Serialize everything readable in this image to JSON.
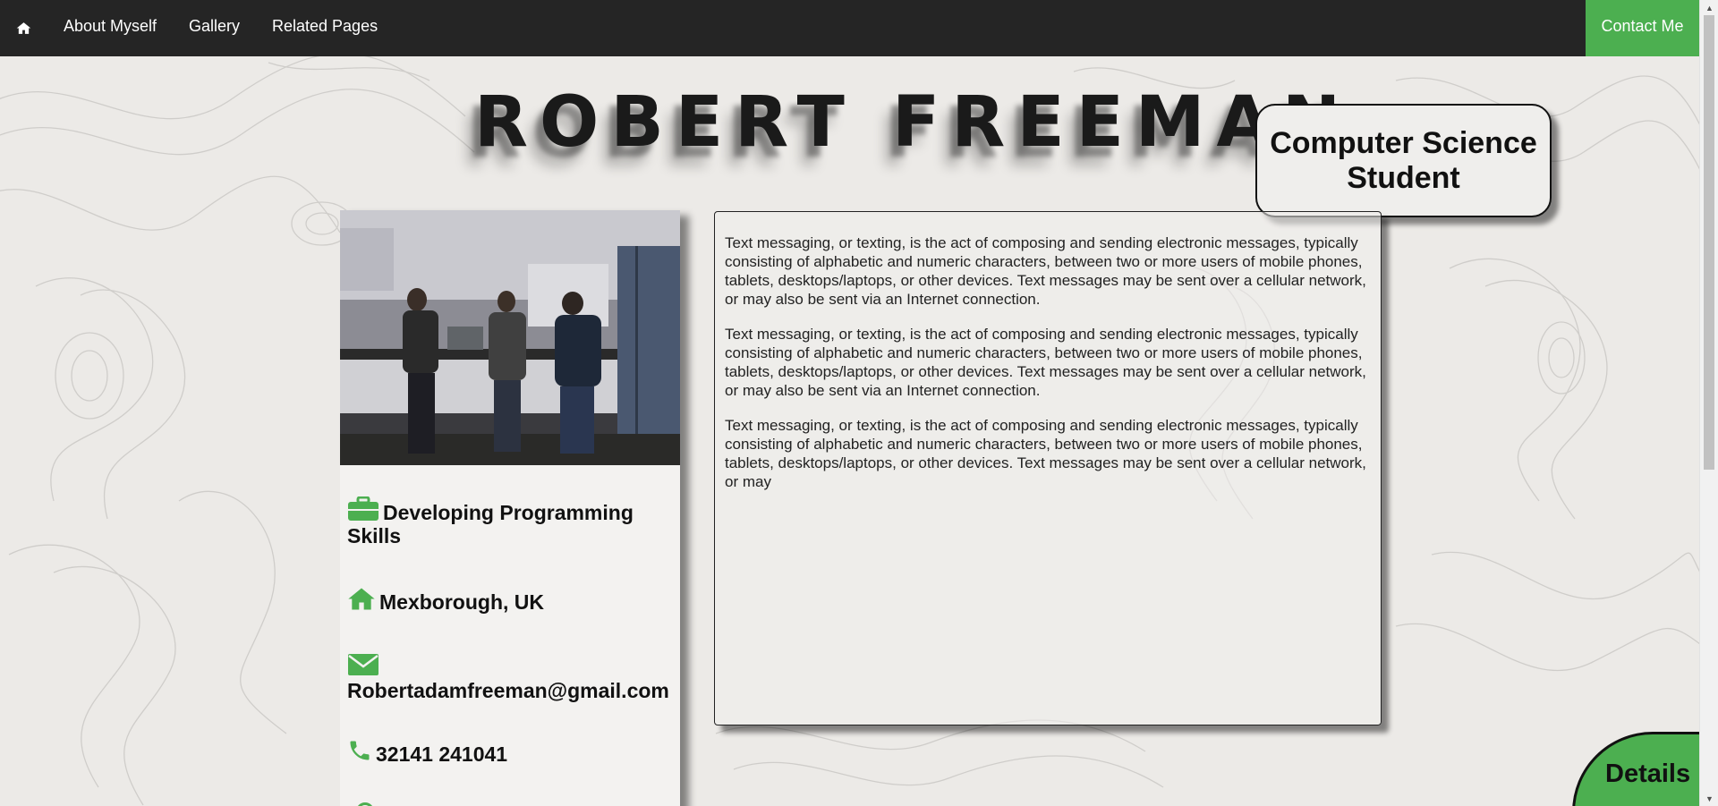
{
  "nav": {
    "home_icon": "home-icon",
    "links": [
      "About Myself",
      "Gallery",
      "Related Pages"
    ],
    "contact": "Contact Me"
  },
  "header": {
    "title": "ROBERT FREEMAN",
    "subtitle": "Computer Science Student"
  },
  "profile": {
    "photo_alt": "students-at-workbench-photo",
    "items": [
      {
        "icon": "briefcase-icon",
        "text": "Developing Programming Skills"
      },
      {
        "icon": "home-icon",
        "text": "Mexborough, UK"
      },
      {
        "icon": "envelope-icon",
        "text": "Robertadamfreeman@gmail.com"
      },
      {
        "icon": "phone-icon",
        "text": "32141 241041"
      }
    ]
  },
  "content": {
    "paragraphs": [
      "Text messaging, or texting, is the act of composing and sending electronic messages, typically consisting of alphabetic and numeric characters, between two or more users of mobile phones, tablets, desktops/laptops, or other devices. Text messages may be sent over a cellular network, or may also be sent via an Internet connection.",
      "Text messaging, or texting, is the act of composing and sending electronic messages, typically consisting of alphabetic and numeric characters, between two or more users of mobile phones, tablets, desktops/laptops, or other devices. Text messages may be sent over a cellular network, or may also be sent via an Internet connection.",
      "Text messaging, or texting, is the act of composing and sending electronic messages, typically consisting of alphabetic and numeric characters, between two or more users of mobile phones, tablets, desktops/laptops, or other devices. Text messages may be sent over a cellular network, or may"
    ]
  },
  "details": {
    "label": "Details"
  },
  "colors": {
    "accent": "#4caf50",
    "nav_bg": "#252525",
    "text": "#111111"
  }
}
